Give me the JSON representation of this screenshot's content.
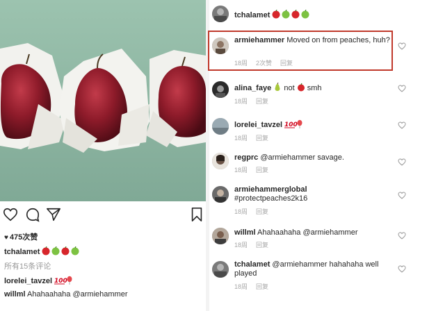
{
  "post": {
    "likes": "475次赞",
    "caption": {
      "username": "tchalamet"
    },
    "view_all": "所有15条评论",
    "preview": [
      {
        "username": "lorelei_tavzel",
        "text": ""
      },
      {
        "username": "willml",
        "text": "Ahahaahaha @armiehammer"
      }
    ],
    "icons": [
      "heart-icon",
      "comment-icon",
      "share-icon",
      "bookmark-icon"
    ]
  },
  "comments": {
    "header": {
      "username": "tchalamet"
    },
    "items": [
      {
        "username": "armiehammer",
        "text": "Moved on from peaches, huh?",
        "time": "18周",
        "likes": "2次赞",
        "reply": "回复"
      },
      {
        "username": "alina_faye",
        "text": "not",
        "text2": "smh",
        "time": "18周",
        "reply": "回复"
      },
      {
        "username": "lorelei_tavzel",
        "text": "",
        "time": "18周",
        "reply": "回复"
      },
      {
        "username": "regprc",
        "text": "@armiehammer savage.",
        "time": "18周",
        "reply": "回复"
      },
      {
        "username": "armiehammerglobal",
        "text": "#protectpeaches2k16",
        "time": "18周",
        "reply": "回复"
      },
      {
        "username": "willml",
        "text": "Ahahaahaha @armiehammer",
        "time": "18周",
        "reply": "回复"
      },
      {
        "username": "tchalamet",
        "text": "@armiehammer hahahaha well played",
        "time": "18周",
        "reply": "回复"
      }
    ]
  },
  "colors": {
    "highlight": "#c0392b",
    "pear": "#8e1b2a",
    "background": "#8fb7a3"
  }
}
